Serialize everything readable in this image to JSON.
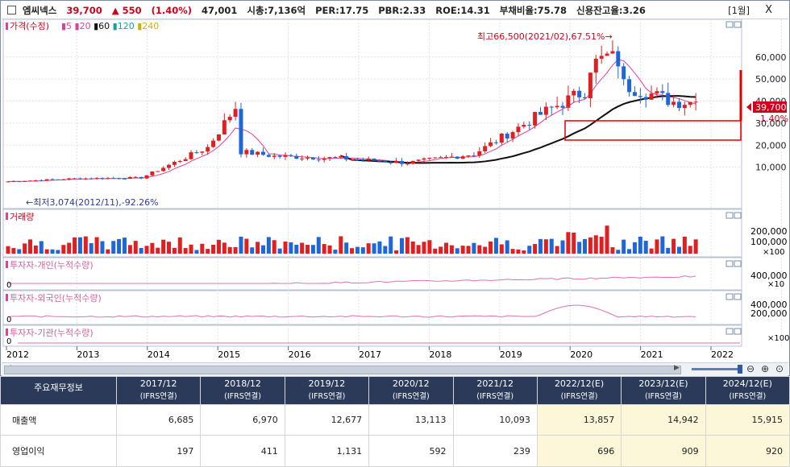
{
  "stock": {
    "name": "엠씨넥스",
    "price": "39,700",
    "change": "▲ 550",
    "change_pct": "(1.40%)",
    "volume": "47,001",
    "market_cap": "시총:7,136억",
    "per": "PER:17.75",
    "pbr": "PBR:2.33",
    "roe": "ROE:14.31",
    "debt_ratio": "부채비율:75.78",
    "credit_ratio": "신용잔고율:3.26",
    "period": "[1월]",
    "close_icon": "X"
  },
  "price_panel": {
    "legend_title": "가격(수정)",
    "ma_labels": [
      "5",
      "20",
      "60",
      "120",
      "240"
    ],
    "ma_colors": [
      "#e0409a",
      "#e0409a",
      "#111111",
      "#1aa0a0",
      "#c8b400"
    ],
    "high_annotation": "최고66,500(2021/02),67.51%→",
    "low_annotation": "←최저3,074(2012/11),-92.26%",
    "y_ticks": [
      "60,000",
      "50,000",
      "40,000",
      "30,000",
      "20,000",
      "10,000"
    ],
    "current_price_tag": "39,700",
    "current_pct_tag": "1.40%"
  },
  "panels": {
    "volume": {
      "title": "거래량",
      "ticks": [
        "200,000",
        "100,000"
      ],
      "unit": "×100"
    },
    "individual": {
      "title": "투자자-개인(누적수량)",
      "ticks": [
        "400,000"
      ],
      "unit": "×10",
      "zero": "0"
    },
    "foreign": {
      "title": "투자자-외국인(누적수량)",
      "ticks": [
        "400,000",
        "200,000"
      ],
      "unit": "",
      "zero": "0"
    },
    "institution": {
      "title": "투자자-기관(누적수량)",
      "ticks": [],
      "unit": "×100",
      "zero": "0"
    }
  },
  "x_axis": [
    "2012",
    "2013",
    "2014",
    "2015",
    "2016",
    "2017",
    "2018",
    "2019",
    "2020",
    "2021",
    "2022"
  ],
  "chart_data": {
    "type": "candlestick",
    "title": "엠씨넥스",
    "period": "monthly",
    "high": {
      "value": 66500,
      "date": "2021/02",
      "pct": 67.51
    },
    "low": {
      "value": 3074,
      "date": "2012/11",
      "pct": -92.26
    },
    "last_close": 39700,
    "ylim": [
      0,
      66500
    ],
    "series": [
      {
        "name": "가격(수정)",
        "x": [
          "2012",
          "2013",
          "2014",
          "2015",
          "2016",
          "2017",
          "2018",
          "2019",
          "2020",
          "2021",
          "2022"
        ],
        "values": [
          3500,
          4800,
          5200,
          19000,
          15000,
          14000,
          12000,
          16000,
          34000,
          50000,
          39700
        ]
      },
      {
        "name": "60",
        "x": [
          "2017",
          "2018",
          "2019",
          "2020",
          "2021",
          "2022"
        ],
        "values": [
          13000,
          12500,
          13500,
          19000,
          30000,
          36000
        ]
      }
    ]
  },
  "financials": {
    "header_label": "주요재무정보",
    "sub_label": "(IFRS연결)",
    "years": [
      "2017/12",
      "2018/12",
      "2019/12",
      "2020/12",
      "2021/12",
      "2022/12(E)",
      "2023/12(E)",
      "2024/12(E)"
    ],
    "rows": [
      {
        "label": "매출액",
        "values": [
          "6,685",
          "6,970",
          "12,677",
          "13,113",
          "10,093",
          "13,857",
          "14,942",
          "15,915"
        ]
      },
      {
        "label": "영업이익",
        "values": [
          "197",
          "411",
          "1,131",
          "592",
          "239",
          "696",
          "909",
          "920"
        ]
      }
    ]
  }
}
